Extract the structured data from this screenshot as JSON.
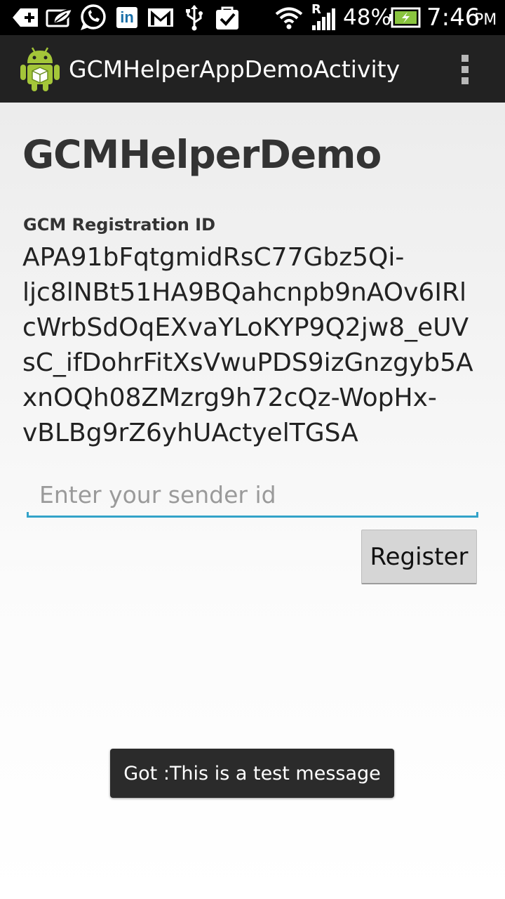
{
  "status_bar": {
    "battery_percent": "48%",
    "time": "7:46",
    "ampm": "PM",
    "roaming_indicator": "R",
    "left_icons": [
      "add-icon",
      "leaf-notification-icon",
      "whatsapp-icon",
      "linkedin-icon",
      "gmail-icon",
      "usb-icon",
      "task-check-icon"
    ],
    "right_icons": [
      "wifi-icon",
      "signal-icon",
      "battery-charging-icon"
    ],
    "linkedin_text": "in"
  },
  "action_bar": {
    "title": "GCMHelperAppDemoActivity",
    "app_icon": "android-robot-icon",
    "overflow_icon": "overflow-menu-icon"
  },
  "main": {
    "heading": "GCMHelperDemo",
    "registration_label": "GCM Registration ID",
    "registration_id_lines": [
      "APA91bFqtgmidRsC77Gbz5Qi-",
      "ljc8lNBt51HA9BQahcnpb9nAOv6IRl",
      "cWrbSdOqEXvaYLoKYP9Q2jw8_eUV",
      "sC_ifDohrFitXsVwuPDS9izGnzgyb5A",
      "xnOQh08ZMzrg9h72cQz-WopHx-",
      "vBLBg9rZ6yhUActyelTGSA"
    ],
    "sender_input": {
      "value": "",
      "placeholder": "Enter your sender id"
    },
    "register_button": "Register"
  },
  "toast": {
    "message": "Got :This is a test message"
  },
  "colors": {
    "accent": "#33a3c9",
    "action_bar": "#222222",
    "android_green": "#a4c639"
  }
}
